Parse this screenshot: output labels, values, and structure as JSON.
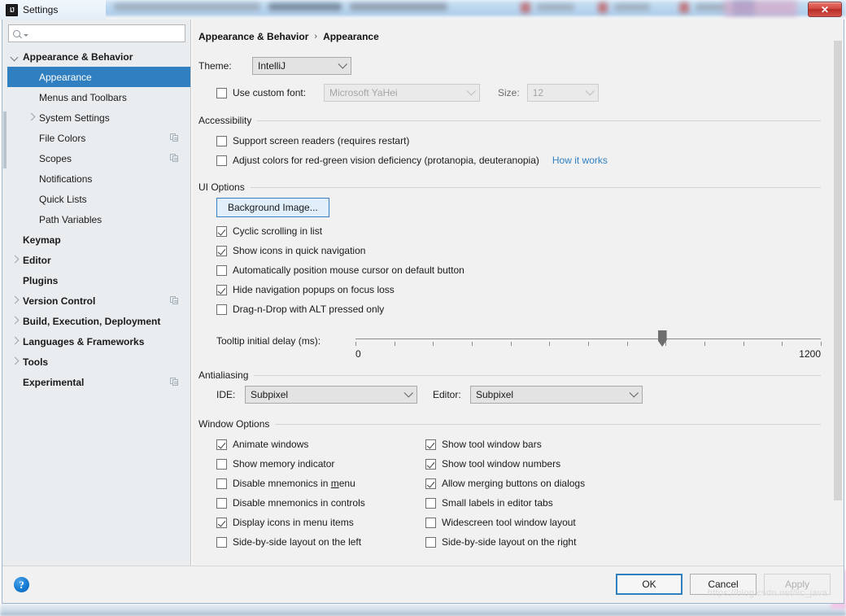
{
  "window": {
    "title": "Settings",
    "logo_text": "IJ",
    "close_label": "✕"
  },
  "sidebar": {
    "search_placeholder": "",
    "search_value": "",
    "search_icon": "search-icon",
    "items": [
      {
        "label": "Appearance & Behavior",
        "level": 0,
        "arrow": "down",
        "selected": false,
        "copy_icon": false
      },
      {
        "label": "Appearance",
        "level": 1,
        "arrow": "none",
        "selected": true,
        "copy_icon": false
      },
      {
        "label": "Menus and Toolbars",
        "level": 1,
        "arrow": "none",
        "selected": false,
        "copy_icon": false
      },
      {
        "label": "System Settings",
        "level": 1,
        "arrow": "right",
        "selected": false,
        "copy_icon": false
      },
      {
        "label": "File Colors",
        "level": 1,
        "arrow": "none",
        "selected": false,
        "copy_icon": true
      },
      {
        "label": "Scopes",
        "level": 1,
        "arrow": "none",
        "selected": false,
        "copy_icon": true
      },
      {
        "label": "Notifications",
        "level": 1,
        "arrow": "none",
        "selected": false,
        "copy_icon": false
      },
      {
        "label": "Quick Lists",
        "level": 1,
        "arrow": "none",
        "selected": false,
        "copy_icon": false
      },
      {
        "label": "Path Variables",
        "level": 1,
        "arrow": "none",
        "selected": false,
        "copy_icon": false
      },
      {
        "label": "Keymap",
        "level": 0,
        "arrow": "none",
        "selected": false,
        "copy_icon": false
      },
      {
        "label": "Editor",
        "level": 0,
        "arrow": "right",
        "selected": false,
        "copy_icon": false
      },
      {
        "label": "Plugins",
        "level": 0,
        "arrow": "none",
        "selected": false,
        "copy_icon": false
      },
      {
        "label": "Version Control",
        "level": 0,
        "arrow": "right",
        "selected": false,
        "copy_icon": true
      },
      {
        "label": "Build, Execution, Deployment",
        "level": 0,
        "arrow": "right",
        "selected": false,
        "copy_icon": false
      },
      {
        "label": "Languages & Frameworks",
        "level": 0,
        "arrow": "right",
        "selected": false,
        "copy_icon": false
      },
      {
        "label": "Tools",
        "level": 0,
        "arrow": "right",
        "selected": false,
        "copy_icon": false
      },
      {
        "label": "Experimental",
        "level": 0,
        "arrow": "none",
        "selected": false,
        "copy_icon": true
      }
    ]
  },
  "main": {
    "breadcrumb": {
      "parent": "Appearance & Behavior",
      "separator": "›",
      "current": "Appearance"
    },
    "theme": {
      "label": "Theme:",
      "value": "IntelliJ"
    },
    "custom_font": {
      "checkbox_label": "Use custom font:",
      "checked": false,
      "font_value": "Microsoft YaHei",
      "size_label": "Size:",
      "size_value": "12",
      "disabled": true
    },
    "accessibility": {
      "title": "Accessibility",
      "items": [
        {
          "label": "Support screen readers (requires restart)",
          "checked": false
        },
        {
          "label": "Adjust colors for red-green vision deficiency (protanopia, deuteranopia)",
          "checked": false
        }
      ],
      "link": "How it works"
    },
    "ui_options": {
      "title": "UI Options",
      "background_image_button": "Background Image...",
      "items": [
        {
          "label": "Cyclic scrolling in list",
          "checked": true
        },
        {
          "label": "Show icons in quick navigation",
          "checked": true
        },
        {
          "label": "Automatically position mouse cursor on default button",
          "checked": false
        },
        {
          "label": "Hide navigation popups on focus loss",
          "checked": true
        },
        {
          "label": "Drag-n-Drop with ALT pressed only",
          "checked": false
        }
      ],
      "tooltip_slider": {
        "label": "Tooltip initial delay (ms):",
        "min_label": "0",
        "max_label": "1200",
        "min": 0,
        "max": 1200,
        "value": 790,
        "tick_count": 13
      }
    },
    "antialiasing": {
      "title": "Antialiasing",
      "ide_label": "IDE:",
      "ide_value": "Subpixel",
      "editor_label": "Editor:",
      "editor_value": "Subpixel"
    },
    "window_options": {
      "title": "Window Options",
      "left_column": [
        {
          "label": "Animate windows",
          "checked": true
        },
        {
          "label": "Show memory indicator",
          "checked": false
        },
        {
          "label": "Disable mnemonics in menu",
          "checked": false,
          "mnemonic": "m"
        },
        {
          "label": "Disable mnemonics in controls",
          "checked": false
        },
        {
          "label": "Display icons in menu items",
          "checked": true
        },
        {
          "label": "Side-by-side layout on the left",
          "checked": false
        }
      ],
      "right_column": [
        {
          "label": "Show tool window bars",
          "checked": true
        },
        {
          "label": "Show tool window numbers",
          "checked": true
        },
        {
          "label": "Allow merging buttons on dialogs",
          "checked": true
        },
        {
          "label": "Small labels in editor tabs",
          "checked": false
        },
        {
          "label": "Widescreen tool window layout",
          "checked": false
        },
        {
          "label": "Side-by-side layout on the right",
          "checked": false
        }
      ]
    }
  },
  "footer": {
    "help_glyph": "?",
    "ok": "OK",
    "cancel": "Cancel",
    "apply": "Apply"
  },
  "watermark": "https://blog.csdn.net/lic_java",
  "colors": {
    "accent": "#2f7fc1",
    "sidebar_bg": "#e9edf0",
    "panel_bg": "#f1f1f1",
    "link": "#2f7fc1"
  }
}
